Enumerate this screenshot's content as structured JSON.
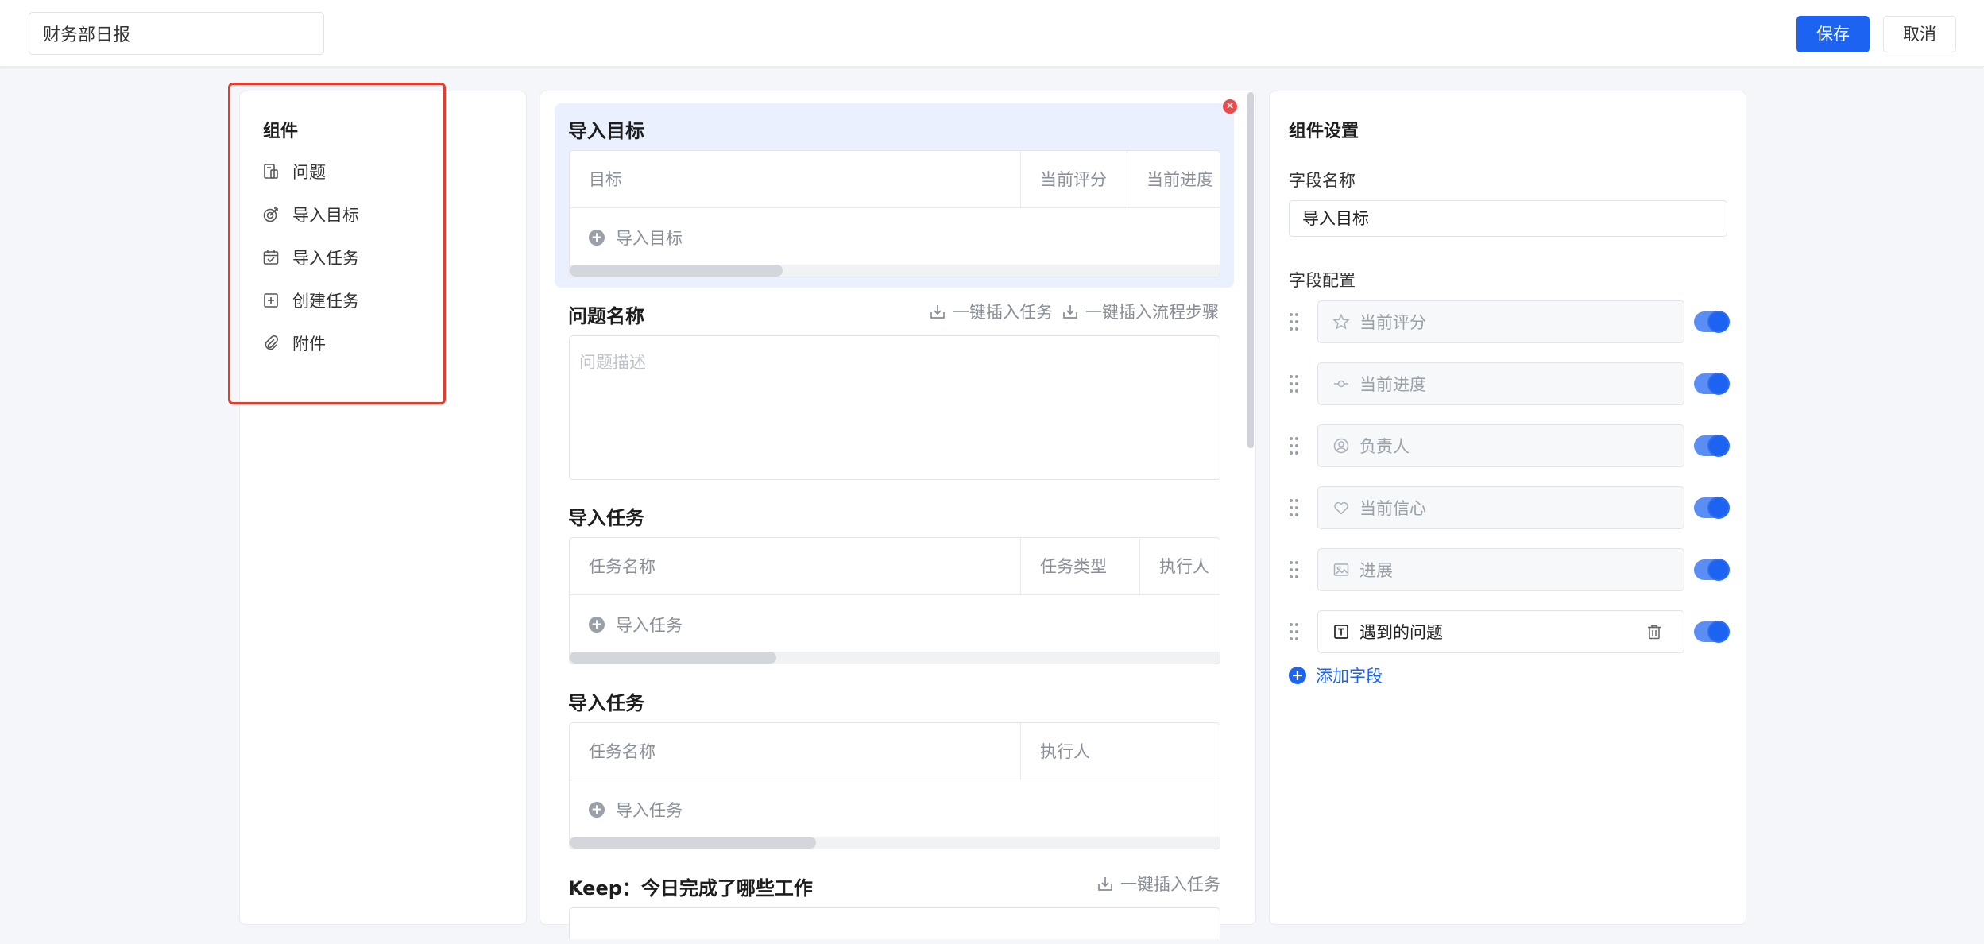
{
  "header": {
    "title_value": "财务部日报",
    "save_label": "保存",
    "cancel_label": "取消"
  },
  "components": {
    "title": "组件",
    "items": [
      {
        "label": "问题",
        "icon": "question-doc-icon"
      },
      {
        "label": "导入目标",
        "icon": "target-icon"
      },
      {
        "label": "导入任务",
        "icon": "calendar-check-icon"
      },
      {
        "label": "创建任务",
        "icon": "plus-square-icon"
      },
      {
        "label": "附件",
        "icon": "paperclip-icon"
      }
    ]
  },
  "canvas": {
    "goal_section": {
      "title": "导入目标",
      "columns": [
        "目标",
        "当前评分",
        "当前进度"
      ],
      "add_label": "导入目标"
    },
    "question_section": {
      "title": "问题名称",
      "action_insert_task": "一键插入任务",
      "action_insert_flow": "一键插入流程步骤",
      "placeholder": "问题描述"
    },
    "task_section_1": {
      "title": "导入任务",
      "columns": [
        "任务名称",
        "任务类型",
        "执行人"
      ],
      "add_label": "导入任务"
    },
    "task_section_2": {
      "title": "导入任务",
      "columns": [
        "任务名称",
        "执行人"
      ],
      "add_label": "导入任务"
    },
    "keep_section": {
      "title": "Keep：今日完成了哪些工作",
      "action_insert_task": "一键插入任务"
    }
  },
  "settings": {
    "title": "组件设置",
    "field_name_label": "字段名称",
    "field_name_value": "导入目标",
    "field_config_label": "字段配置",
    "fields": [
      {
        "label": "当前评分",
        "icon": "star-icon",
        "enabled": true,
        "active": false
      },
      {
        "label": "当前进度",
        "icon": "progress-icon",
        "enabled": true,
        "active": false
      },
      {
        "label": "负责人",
        "icon": "user-circle-icon",
        "enabled": true,
        "active": false
      },
      {
        "label": "当前信心",
        "icon": "heart-icon",
        "enabled": true,
        "active": false
      },
      {
        "label": "进展",
        "icon": "image-icon",
        "enabled": true,
        "active": false
      },
      {
        "label": "遇到的问题",
        "icon": "text-box-icon",
        "enabled": true,
        "active": true
      }
    ],
    "add_field_label": "添加字段"
  },
  "colors": {
    "primary": "#1b63f0",
    "selected_block_bg": "#eaf0fd",
    "highlight_border": "#e23c2c",
    "close_badge": "#ee4a4a"
  }
}
